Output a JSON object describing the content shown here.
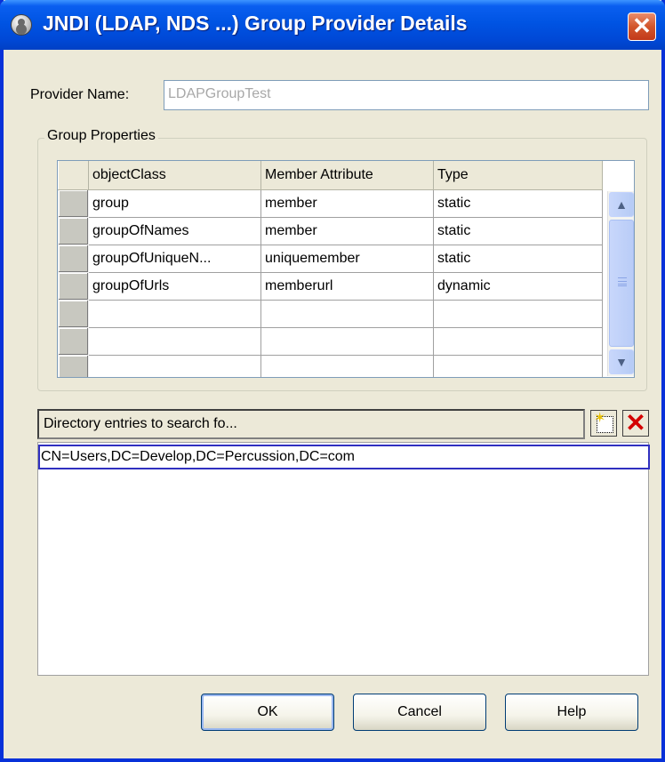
{
  "window": {
    "title": "JNDI (LDAP, NDS ...) Group Provider Details",
    "close_glyph": "✕"
  },
  "provider": {
    "label": "Provider Name:",
    "value": "LDAPGroupTest"
  },
  "group_properties": {
    "legend": "Group Properties",
    "columns": [
      "objectClass",
      "Member Attribute",
      "Type"
    ],
    "rows": [
      [
        "group",
        "member",
        "static"
      ],
      [
        "groupOfNames",
        "member",
        "static"
      ],
      [
        "groupOfUniqueN...",
        "uniquemember",
        "static"
      ],
      [
        "groupOfUrls",
        "memberurl",
        "dynamic"
      ],
      [
        "",
        "",
        ""
      ],
      [
        "",
        "",
        ""
      ],
      [
        "",
        "",
        ""
      ]
    ],
    "scroll_up_glyph": "▲",
    "scroll_down_glyph": "▼"
  },
  "directory": {
    "header": "Directory entries to search fo...",
    "new_icon": "new-entry-icon",
    "delete_glyph": "✕",
    "entries": [
      "CN=Users,DC=Develop,DC=Percussion,DC=com"
    ]
  },
  "buttons": {
    "ok": "OK",
    "cancel": "Cancel",
    "help": "Help"
  },
  "colors": {
    "titlebar": "#0054e3",
    "dialog_bg": "#ece9d8",
    "close_button": "#d2562c",
    "selection_border": "#3030c0"
  }
}
